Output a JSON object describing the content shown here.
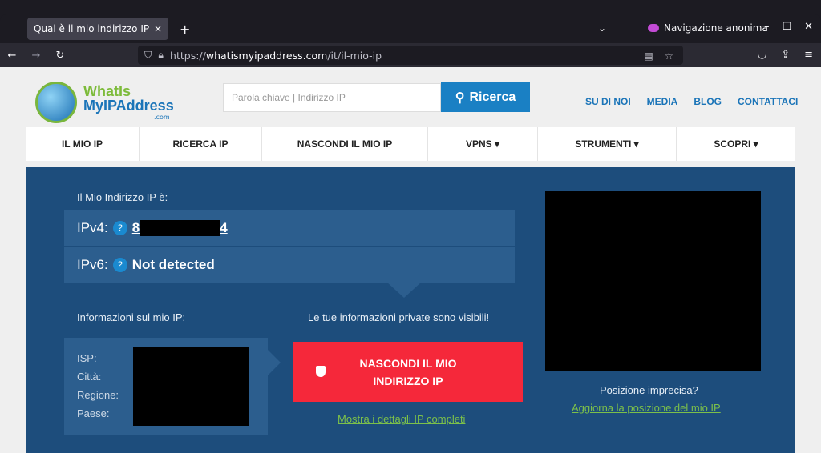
{
  "browser": {
    "tab_title": "Qual è il mio indirizzo IP - Vis",
    "tab_close": "×",
    "new_tab": "+",
    "private_label": "Navigazione anonima",
    "url_prefix": "https://",
    "url_domain": "whatismyipaddress.com",
    "url_path": "/it/il-mio-ip"
  },
  "header": {
    "logo_line1": "WhatIs",
    "logo_line2": "MyIPAddress",
    "logo_line3": ".com",
    "search_placeholder": "Parola chiave | Indirizzo IP",
    "search_button": "Ricerca",
    "links": [
      "SU DI NOI",
      "MEDIA",
      "BLOG",
      "CONTATTACI"
    ]
  },
  "menu": [
    "IL MIO IP",
    "RICERCA IP",
    "NASCONDI IL MIO IP",
    "VPNS ▾",
    "STRUMENTI ▾",
    "SCOPRI ▾"
  ],
  "main": {
    "my_ip_label": "Il Mio Indirizzo IP è:",
    "ipv4_label": "IPv4:",
    "ipv4_start": "8",
    "ipv4_end": "4",
    "ipv6_label": "IPv6:",
    "ipv6_value": "Not detected",
    "help": "?",
    "info_label": "Informazioni sul mio IP:",
    "private_visible": "Le tue informazioni private sono visibili!",
    "isp": "ISP:",
    "city": "Città:",
    "region": "Regione:",
    "country": "Paese:",
    "hide_button_line1": "NASCONDI IL MIO",
    "hide_button_line2": "INDIRIZZO IP",
    "details_link": "Mostra i dettagli IP completi",
    "precise": "Posizione imprecisa?",
    "update_link": "Aggiorna la posizione del mio IP"
  }
}
